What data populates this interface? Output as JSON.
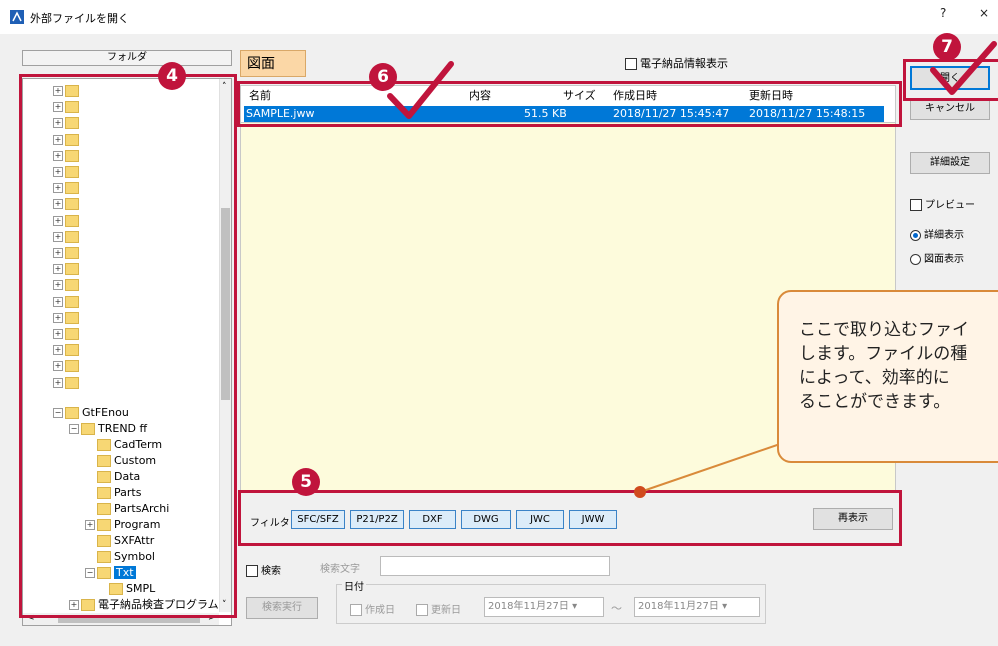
{
  "window": {
    "title": "外部ファイルを開く",
    "help": "?",
    "close": "×"
  },
  "left_panel": {
    "header": "フォルダ",
    "tree": [
      {
        "label": "GtFEnou"
      },
      {
        "label": "TREND ff"
      },
      {
        "label": "CadTerm"
      },
      {
        "label": "Custom"
      },
      {
        "label": "Data"
      },
      {
        "label": "Parts"
      },
      {
        "label": "PartsArchi"
      },
      {
        "label": "Program"
      },
      {
        "label": "SXFAttr"
      },
      {
        "label": "Symbol"
      },
      {
        "label": "Txt"
      },
      {
        "label": "SMPL"
      },
      {
        "label": "電子納品検査プログラム"
      }
    ]
  },
  "tab": {
    "label": "図面"
  },
  "electronic_check": {
    "label": "電子納品情報表示"
  },
  "file_list": {
    "columns": [
      "名前",
      "内容",
      "サイズ",
      "作成日時",
      "更新日時"
    ],
    "rows": [
      {
        "name": "SAMPLE.jww",
        "content": "",
        "size": "51.5 KB",
        "created": "2018/11/27 15:45:47",
        "updated": "2018/11/27 15:48:15"
      }
    ]
  },
  "right_panel": {
    "open": "開く",
    "cancel": "キャンセル",
    "detail_settings": "詳細設定",
    "preview": "プレビュー",
    "view_detail": "詳細表示",
    "view_drawing": "図面表示"
  },
  "filter": {
    "label": "フィルタ",
    "buttons": [
      "SFC/SFZ",
      "P21/P2Z",
      "DXF",
      "DWG",
      "JWC",
      "JWW"
    ],
    "refresh": "再表示"
  },
  "search": {
    "check_label": "検索",
    "text_label": "検索文字",
    "date_label": "日付",
    "run": "検索実行",
    "created": "作成日",
    "updated": "更新日",
    "date_from": "2018年11月27日",
    "tilde": "～",
    "date_to": "2018年11月27日"
  },
  "annotations": {
    "badge4": "4",
    "badge5": "5",
    "badge6": "6",
    "badge7": "7",
    "callout_lines": [
      "ここで取り込むファイ",
      "します。ファイルの種",
      "によって、効率的に",
      "ることができます。"
    ]
  },
  "colors": {
    "accent": "#c0143c",
    "selection": "#0078d7",
    "preview_bg": "#fdfbdc",
    "callout_border": "#d98a3a"
  }
}
